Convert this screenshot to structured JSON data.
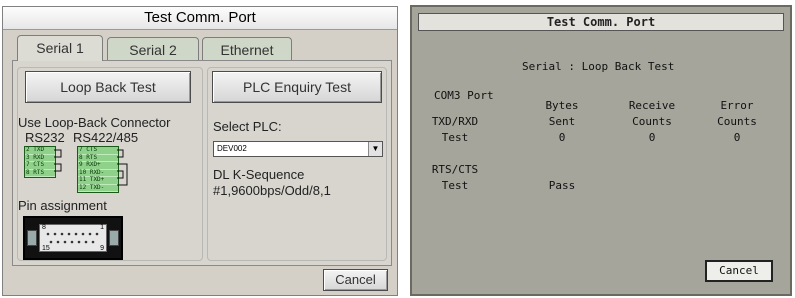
{
  "left": {
    "title": "Test Comm. Port",
    "tabs": [
      "Serial 1",
      "Serial 2",
      "Ethernet"
    ],
    "loop_back_button": "Loop Back Test",
    "plc_enquiry_button": "PLC Enquiry Test",
    "use_connector_label": "Use Loop-Back Connector",
    "rs232_label": "RS232",
    "rs422_label": "RS422/485",
    "rs232_pins": [
      "2 TXD",
      "3 RXD",
      "7 CTS",
      "8 RTS"
    ],
    "rs422_pins": [
      "7 CTS",
      "8 RTS",
      "9 RXD+",
      "10 RXD-",
      "11 TXD+",
      "12 TXD-"
    ],
    "pin_assignment_label": "Pin assignment",
    "connector_pins": [
      "8",
      "1",
      "15",
      "9"
    ],
    "select_plc_label": "Select PLC:",
    "select_plc_value": "DEV002",
    "protocol_line1": "DL K-Sequence",
    "protocol_line2": "#1,9600bps/Odd/8,1",
    "cancel_button": "Cancel"
  },
  "right": {
    "title": "Test Comm. Port",
    "subtitle": "Serial : Loop Back Test",
    "port_label": "COM3 Port",
    "col_bytes": [
      "Bytes",
      "Sent"
    ],
    "col_receive": [
      "Receive",
      "Counts"
    ],
    "col_error": [
      "Error",
      "Counts"
    ],
    "row1_label": [
      "TXD/RXD",
      "Test"
    ],
    "row1_values": [
      "0",
      "0",
      "0"
    ],
    "row2_label": [
      "RTS/CTS",
      "Test"
    ],
    "row2_result": "Pass",
    "cancel_button": "Cancel"
  }
}
